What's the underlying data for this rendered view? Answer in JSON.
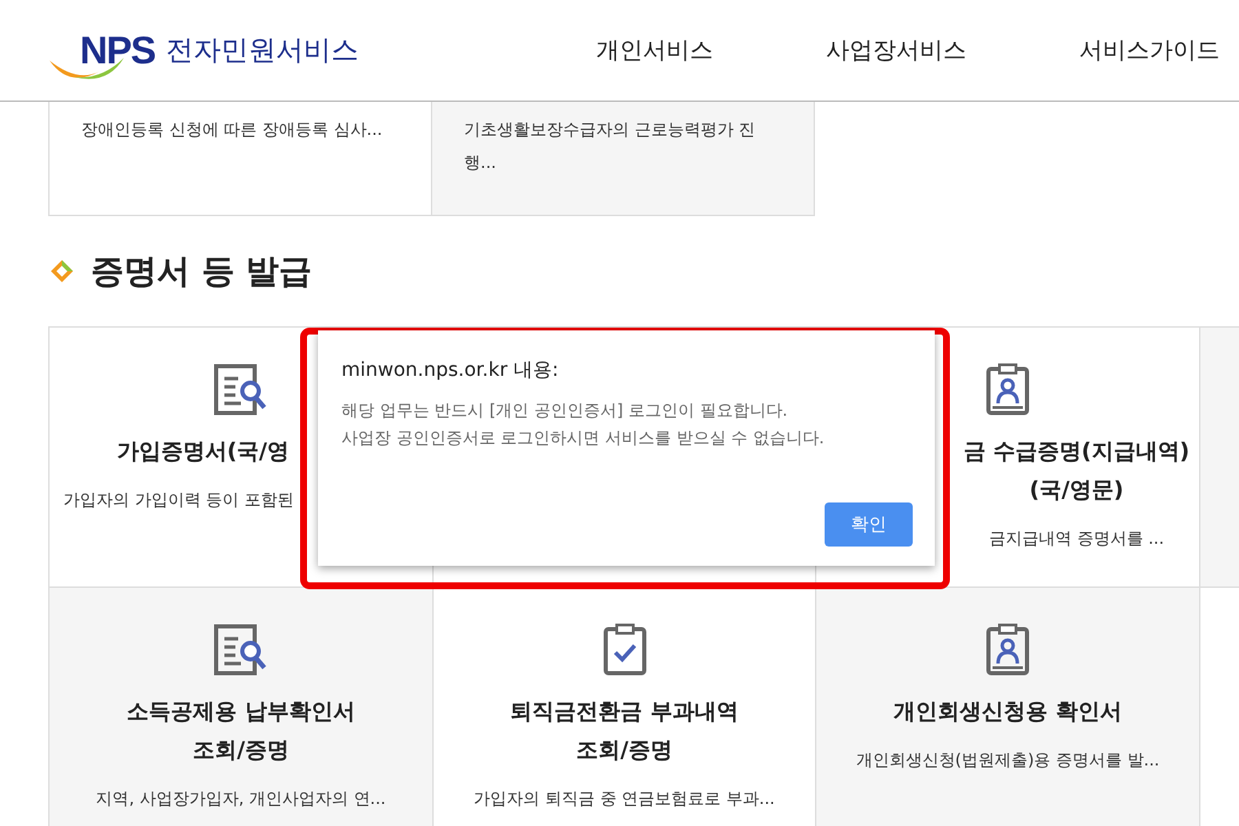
{
  "header": {
    "logo": {
      "mark": "NPS",
      "text": "전자민원서비스"
    },
    "nav": [
      "개인서비스",
      "사업장서비스",
      "서비스가이드"
    ]
  },
  "upper_cards": [
    {
      "description": "장애인등록 신청에 따른 장애등록 심사..."
    },
    {
      "description": "기초생활보장수급자의 근로능력평가 진행..."
    }
  ],
  "section": {
    "title": "증명서 등 발급"
  },
  "cards": [
    {
      "kind": "document-search",
      "title": [
        "가입증명서(국/영"
      ],
      "description": "가입자의 가입이력 등이 포함된"
    },
    {
      "kind": "empty"
    },
    {
      "kind": "id-badge",
      "title": [
        "금 수급증명(지급내역)",
        "(국/영문)"
      ],
      "description": "금지급내역 증명서를 ..."
    },
    {
      "kind": "empty"
    },
    {
      "kind": "document-search",
      "title": [
        "소득공제용 납부확인서",
        "조회/증명"
      ],
      "description": "지역, 사업장가입자, 개인사업자의 연..."
    },
    {
      "kind": "clipboard-check",
      "title": [
        "퇴직금전환금 부과내역",
        "조회/증명"
      ],
      "description": "가입자의 퇴직금 중 연금보험료로 부과..."
    },
    {
      "kind": "id-badge",
      "title": [
        "개인회생신청용 확인서"
      ],
      "description": "개인회생신청(법원제출)용 증명서를 발..."
    },
    {
      "kind": "empty"
    }
  ],
  "dialog": {
    "title": "minwon.nps.or.kr 내용:",
    "message": [
      "해당 업무는 반드시 [개인 공인인증서] 로그인이 필요합니다.",
      "사업장 공인인증서로 로그인하시면 서비스를 받으실 수 없습니다."
    ],
    "button": "확인"
  }
}
